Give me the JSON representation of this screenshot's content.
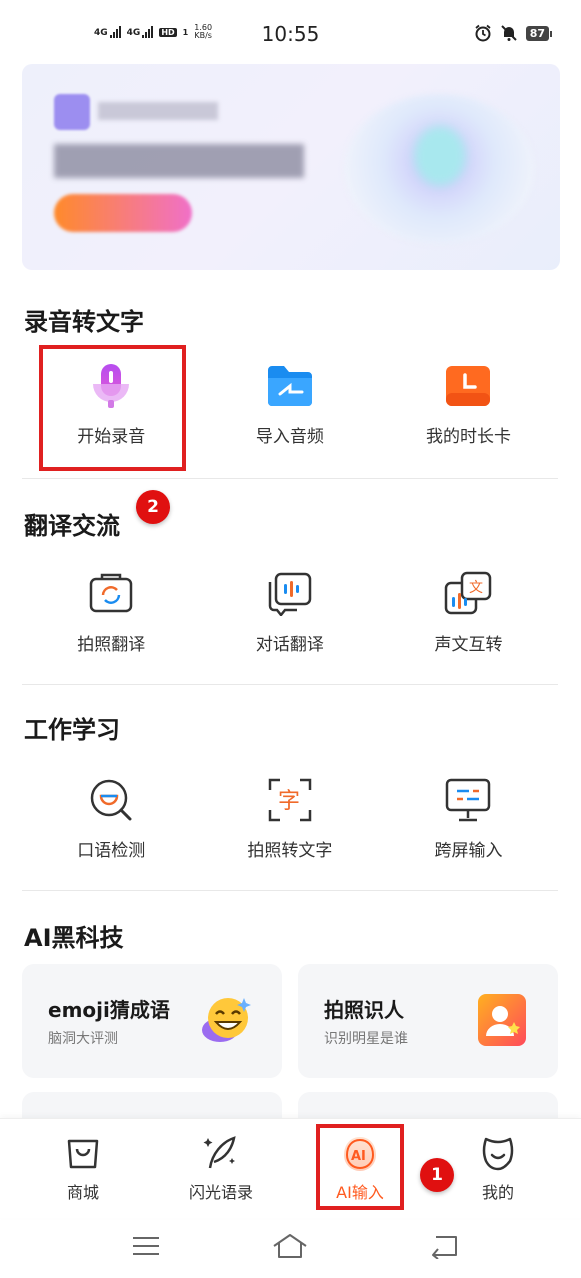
{
  "status_bar": {
    "signal1": "4G",
    "signal2": "4G",
    "hd": "HD",
    "sim": "1",
    "speed_value": "1.60",
    "speed_unit": "KB/s",
    "time": "10:55",
    "battery": "87",
    "icons": [
      "alarm-icon",
      "mute-icon",
      "battery-icon"
    ]
  },
  "banner": {
    "icon": "blurred-promo-banner"
  },
  "sections": {
    "recording": {
      "title": "录音转文字",
      "items": [
        {
          "label": "开始录音",
          "icon": "microphone-icon"
        },
        {
          "label": "导入音频",
          "icon": "folder-icon"
        },
        {
          "label": "我的时长卡",
          "icon": "clock-card-icon"
        }
      ]
    },
    "translate": {
      "title": "翻译交流",
      "items": [
        {
          "label": "拍照翻译",
          "icon": "camera-translate-icon"
        },
        {
          "label": "对话翻译",
          "icon": "dialog-translate-icon"
        },
        {
          "label": "声文互转",
          "icon": "voice-text-convert-icon"
        }
      ]
    },
    "work": {
      "title": "工作学习",
      "items": [
        {
          "label": "口语检测",
          "icon": "speech-check-icon"
        },
        {
          "label": "拍照转文字",
          "icon": "scan-text-icon"
        },
        {
          "label": "跨屏输入",
          "icon": "cross-screen-icon"
        }
      ]
    },
    "ai": {
      "title": "AI黑科技",
      "cards": [
        {
          "title": "emoji猜成语",
          "subtitle": "脑洞大评测",
          "icon": "emoji-face-icon"
        },
        {
          "title": "拍照识人",
          "subtitle": "识别明星是谁",
          "icon": "face-recognition-icon"
        }
      ]
    }
  },
  "annotations": {
    "badge_1": "1",
    "badge_2": "2"
  },
  "bottom_nav": [
    {
      "label": "商城",
      "icon": "shop-bag-icon"
    },
    {
      "label": "闪光语录",
      "icon": "quill-sparkle-icon"
    },
    {
      "label": "AI输入",
      "icon": "ai-input-icon",
      "active": true
    },
    {
      "label": "我的",
      "icon": "profile-face-icon"
    }
  ],
  "colors": {
    "accent": "#ff5a1f",
    "highlight": "#e02020",
    "mic": "#c64ef0",
    "folder": "#1a8cf0",
    "clock": "#ff6a20"
  }
}
